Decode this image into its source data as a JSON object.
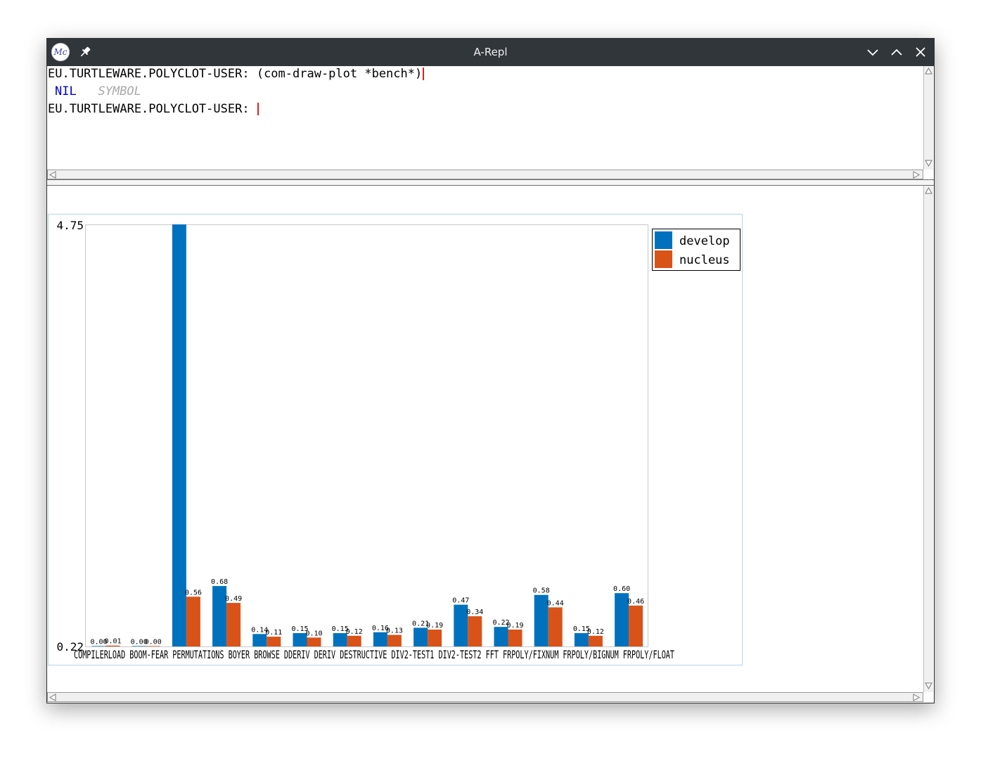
{
  "window": {
    "title": "A-Repl",
    "app_icon": "Mc",
    "icons": [
      "mcclim-app-icon",
      "pin-icon",
      "minimize-icon",
      "maximize-icon",
      "close-icon"
    ]
  },
  "repl": {
    "prompt": "EU.TURTLEWARE.POLYCLOT-USER:",
    "command": "(com-draw-plot *bench*)",
    "result_value": "NIL",
    "result_type": "SYMBOL",
    "prompt2": "EU.TURTLEWARE.POLYCLOT-USER:"
  },
  "colors": {
    "titlebar": "#31363b",
    "develop": "#0072bd",
    "nucleus": "#d95319",
    "caret": "#e02020",
    "nil": "#0000cc",
    "symbol": "#a8a8a8"
  },
  "chart_data": {
    "type": "bar",
    "title": "",
    "xlabel": "",
    "ylabel": "",
    "ylim": [
      0.0,
      4.75
    ],
    "y_tick_labels": [
      "0.22",
      "4.75"
    ],
    "categories": [
      "COMPILER",
      "LOAD",
      "BOOM-FEAR",
      "PERMUTATIONS",
      "BOYER",
      "BROWSE",
      "DDERIV",
      "DERIV",
      "DESTRUCTIVE",
      "DIV2-TEST1",
      "DIV2-TEST2",
      "FFT",
      "FRPOLY/FIXNUM",
      "FRPOLY/BIGNUM",
      "FRPOLY/FLOAT"
    ],
    "axis_label_text": "COMPILERLOAD BOOM-FEAR PERMUTATIONS BOYER BROWSE DDERIV DERIV DESTRUCTIVE DIV2-TEST1 DIV2-TEST2 FFT FRPOLY/FIXNUM FRPOLY/BIGNUM FRPOLY/FLOAT",
    "series": [
      {
        "name": "develop",
        "color": "#0072bd",
        "values": [
          0.0,
          0.0,
          4.75,
          0.68,
          0.14,
          0.15,
          0.15,
          0.16,
          0.21,
          0.47,
          0.22,
          0.58,
          0.15,
          0.6
        ],
        "labels": [
          "0.00",
          "0.00",
          "",
          "0.68",
          "0.14",
          "0.15",
          "0.15",
          "0.16",
          "0.21",
          "0.47",
          "0.22",
          "0.58",
          "0.15",
          "0.60"
        ]
      },
      {
        "name": "nucleus",
        "color": "#d95319",
        "values": [
          0.01,
          0.0,
          0.56,
          0.49,
          0.11,
          0.1,
          0.12,
          0.13,
          0.19,
          0.34,
          0.19,
          0.44,
          0.12,
          0.46
        ],
        "labels": [
          "0.01",
          "0.00",
          "0.56",
          "0.49",
          "0.11",
          "0.10",
          "0.12",
          "0.13",
          "0.19",
          "0.34",
          "0.19",
          "0.44",
          "0.12",
          "0.46"
        ]
      }
    ],
    "legend_placement": "top-right",
    "grid": false
  }
}
